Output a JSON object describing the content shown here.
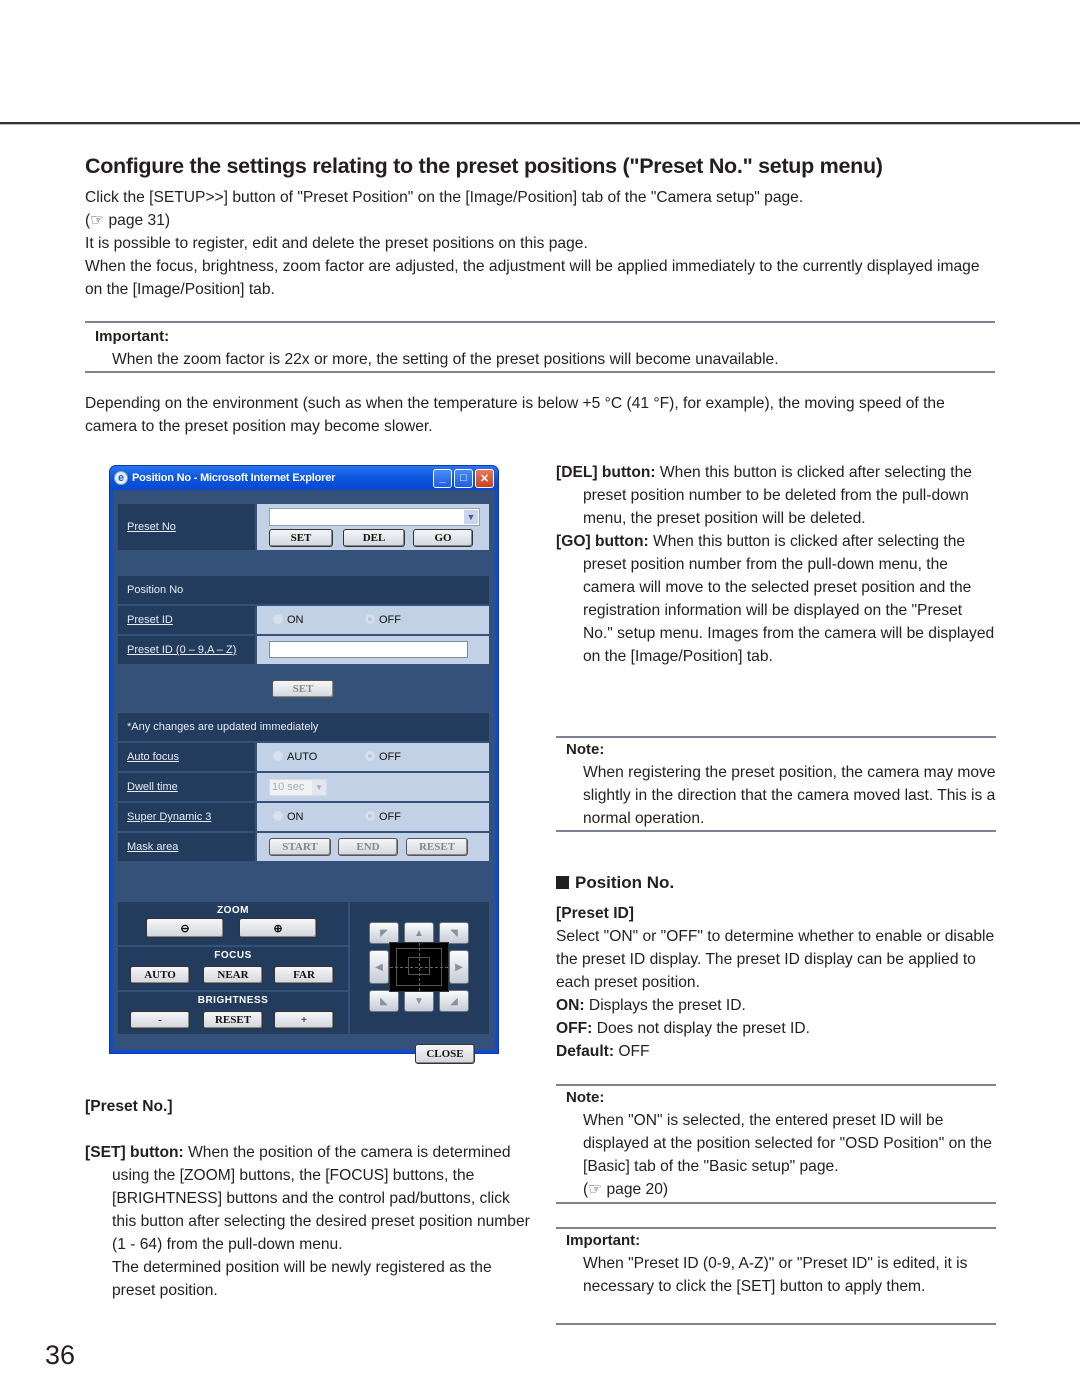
{
  "section_heading": "Configure the settings relating to the preset positions (\"Preset No.\" setup menu)",
  "intro": [
    "Click the [SETUP>>] button of \"Preset Position\" on the [Image/Position] tab of the \"Camera setup\" page.",
    "(☞ page 31)",
    "It is possible to register, edit and delete the preset positions on this page.",
    "When the focus, brightness, zoom factor are adjusted, the adjustment will be applied immediately to the currently displayed image on the [Image/Position] tab."
  ],
  "important_1": {
    "title": "Important:",
    "body": "When the zoom factor is 22x or more, the setting of the preset positions will become unavailable."
  },
  "environment_note": "Depending on the environment (such as when the temperature is below +5 °C (41 °F), for example), the moving speed of the camera to the preset position may become slower.",
  "window": {
    "title": "Position No - Microsoft Internet Explorer",
    "controls": {
      "minimize": "_",
      "maximize": "□",
      "close": "✕"
    },
    "preset_no": {
      "label": "Preset No",
      "select_value": "",
      "buttons": [
        "SET",
        "DEL",
        "GO"
      ]
    },
    "position_no_band": "Position No",
    "preset_id": {
      "label": "Preset ID",
      "options": [
        "ON",
        "OFF"
      ],
      "selected": "OFF"
    },
    "preset_id_text": {
      "label": "Preset ID (0 – 9,A – Z)",
      "value": ""
    },
    "set_button": "SET",
    "notice_band": "*Any changes are updated immediately",
    "auto_focus": {
      "label": "Auto focus",
      "options": [
        "AUTO",
        "OFF"
      ],
      "selected": "OFF"
    },
    "dwell_time": {
      "label": "Dwell time",
      "value": "10 sec"
    },
    "super_dynamic": {
      "label": "Super Dynamic 3",
      "options": [
        "ON",
        "OFF"
      ],
      "selected": "OFF"
    },
    "mask_area": {
      "label": "Mask area",
      "buttons": [
        "START",
        "END",
        "RESET"
      ]
    },
    "zoom": {
      "title": "ZOOM",
      "buttons": [
        "zoom-out",
        "zoom-in"
      ]
    },
    "focus": {
      "title": "FOCUS",
      "buttons": [
        "AUTO",
        "NEAR",
        "FAR"
      ]
    },
    "brightness": {
      "title": "BRIGHTNESS",
      "buttons": [
        "-",
        "RESET",
        "+"
      ]
    },
    "pad": {
      "up": "▲",
      "down": "▼",
      "left": "◀",
      "right": "▶",
      "upleft": "◤",
      "upright": "◥",
      "downleft": "◣",
      "downright": "◢"
    },
    "close_button": "CLOSE"
  },
  "del_button": {
    "label": "[DEL] button:",
    "text": " When this button is clicked after selecting the preset position number to be deleted from the pull-down menu, the preset position will be deleted."
  },
  "go_button": {
    "label": "[GO] button:",
    "text": " When this button is clicked after selecting the preset position number from the pull-down menu, the camera will move to the selected preset position and the registration information will be displayed on the \"Preset No.\" setup menu. Images from the camera will be displayed on the [Image/Position] tab."
  },
  "note_1": {
    "title": "Note:",
    "body": "When registering the preset position, the camera may move slightly in the direction that the camera moved last. This is a normal operation."
  },
  "position_no": {
    "heading": "Position No.",
    "subheading": "[Preset ID]",
    "desc": "Select \"ON\" or \"OFF\" to determine whether to enable or disable the preset ID display. The preset ID display can be applied to each preset position.",
    "on_label": "ON:",
    "on_text": " Displays the preset ID.",
    "off_label": "OFF:",
    "off_text": " Does not display the preset ID.",
    "default_label": "Default:",
    "default_text": " OFF"
  },
  "note_2": {
    "title": "Note:",
    "body": "When \"ON\" is selected, the entered preset ID will be displayed at the position selected for \"OSD Position\" on the [Basic] tab of the \"Basic setup\" page.",
    "ref": "(☞ page 20)"
  },
  "important_2": {
    "title": "Important:",
    "body": "When \"Preset ID (0-9, A-Z)\" or \"Preset ID\" is edited, it is necessary to click the [SET] button to apply them."
  },
  "preset_no_section": {
    "heading": "[Preset No.]",
    "set_label": "[SET] button:",
    "set_text": " When the position of the camera is determined using the [ZOOM] buttons, the [FOCUS] buttons, the [BRIGHTNESS] buttons and the control pad/buttons, click this button after selecting the desired preset position number (1 - 64) from the pull-down menu.",
    "set_text_2": "The determined position will be newly registered as the preset position."
  },
  "page_number": "36"
}
